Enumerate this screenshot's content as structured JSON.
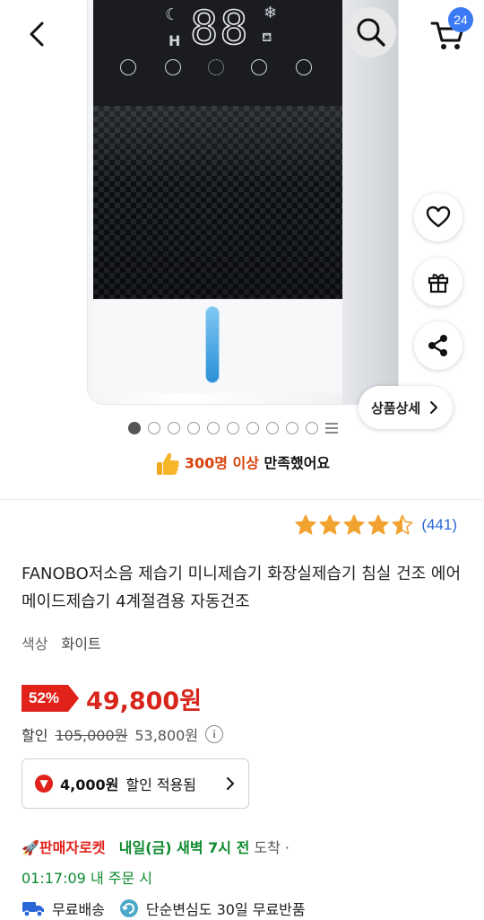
{
  "colors": {
    "discount_red": "#e0221a",
    "price_red": "#d8261c",
    "link_blue": "#2b66d9",
    "delivery_green": "#0c8a2e",
    "badge_blue": "#3a7bf5"
  },
  "hero": {
    "image_alt": "FANOBO 제습기",
    "display_digits": "88",
    "display_mode_letter": "H",
    "pager": {
      "total": 10,
      "active_index": 0
    }
  },
  "nav": {
    "back_icon": "chevron-left-icon",
    "search_icon": "search-icon",
    "cart_icon": "cart-icon",
    "cart_count": "24"
  },
  "side_actions": {
    "wishlist_icon": "heart-icon",
    "gift_icon": "gift-icon",
    "share_icon": "share-icon",
    "detail_label": "상품상세"
  },
  "satisfaction": {
    "highlight": "300명 이상",
    "rest": "만족했어요"
  },
  "rating": {
    "stars": 4.5,
    "count": "(441)"
  },
  "product": {
    "title": "FANOBO저소음 제습기 미니제습기 화장실제습기 침실 건조 에어메이드제습기 4계절겸용 자동건조",
    "option_key": "색상",
    "option_value": "화이트"
  },
  "price": {
    "discount_rate": "52%",
    "sale_price": "49,800원",
    "discount_label": "할인",
    "original_price": "105,000원",
    "discount_amount": "53,800원"
  },
  "coupon": {
    "amount": "4,000원",
    "label": "할인 적용됨"
  },
  "delivery": {
    "rocket_label": "판매자로켓",
    "eta": "내일(금) 새벽 7시 전",
    "arrive": "도착 ·",
    "countdown": "01:17:09",
    "order_within": "내 주문 시"
  },
  "shipping": {
    "free_shipping": "무료배송",
    "return_policy": "단순변심도 30일 무료반품"
  }
}
